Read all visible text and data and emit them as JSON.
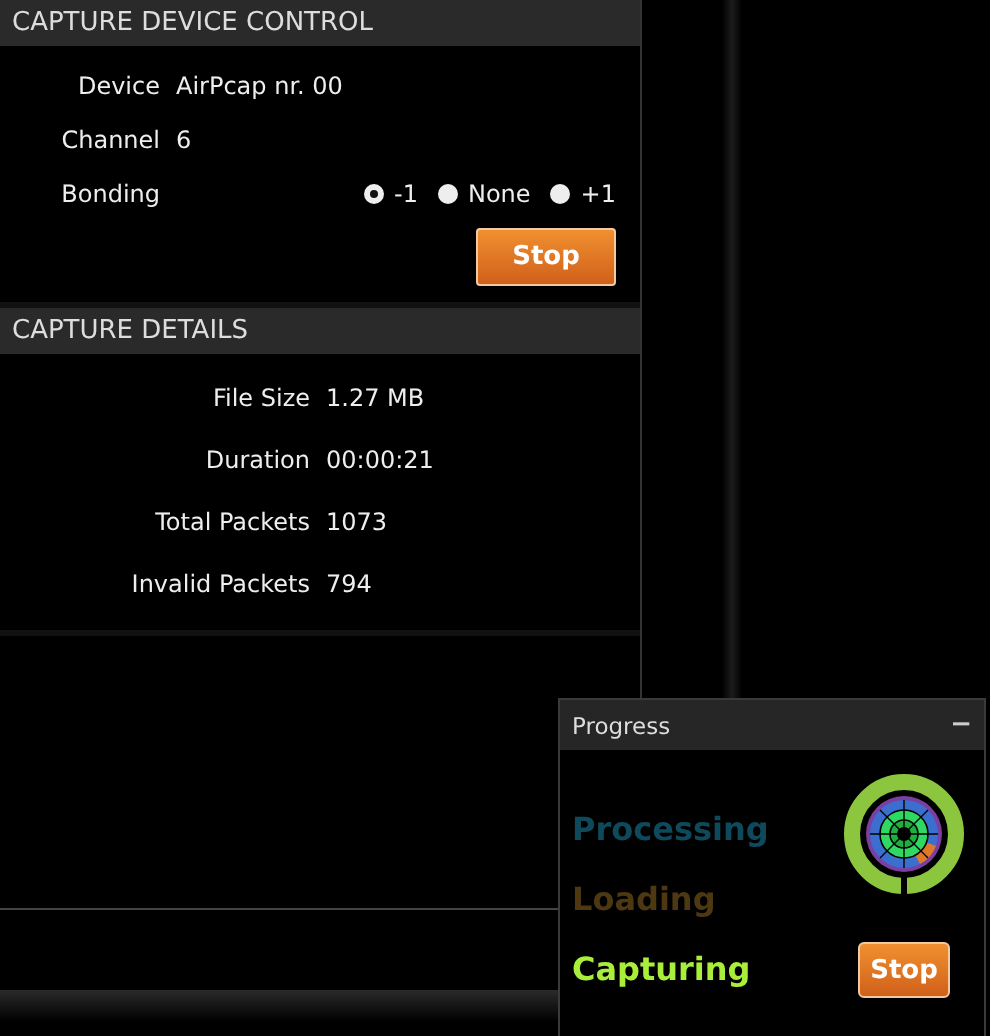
{
  "device_control": {
    "title": "CAPTURE DEVICE CONTROL",
    "fields": [
      {
        "label": "Device",
        "value": "AirPcap nr. 00"
      },
      {
        "label": "Channel",
        "value": "6"
      }
    ],
    "bonding": {
      "label": "Bonding",
      "options": [
        {
          "label": "-1",
          "selected": true
        },
        {
          "label": "None",
          "selected": false
        },
        {
          "label": "+1",
          "selected": false
        }
      ]
    },
    "stop_button": "Stop"
  },
  "capture_details": {
    "title": "CAPTURE DETAILS",
    "fields": [
      {
        "label": "File Size",
        "value": "1.27 MB"
      },
      {
        "label": "Duration",
        "value": "00:00:21"
      },
      {
        "label": "Total Packets",
        "value": "1073"
      },
      {
        "label": "Invalid Packets",
        "value": "794"
      }
    ]
  },
  "progress": {
    "title": "Progress",
    "minimize": "−",
    "stages": [
      {
        "label": "Processing",
        "color": "#0f4a5c"
      },
      {
        "label": "Loading",
        "color": "#4d3812"
      },
      {
        "label": "Capturing",
        "color": "#a8ee3a"
      }
    ],
    "stop_button": "Stop"
  }
}
